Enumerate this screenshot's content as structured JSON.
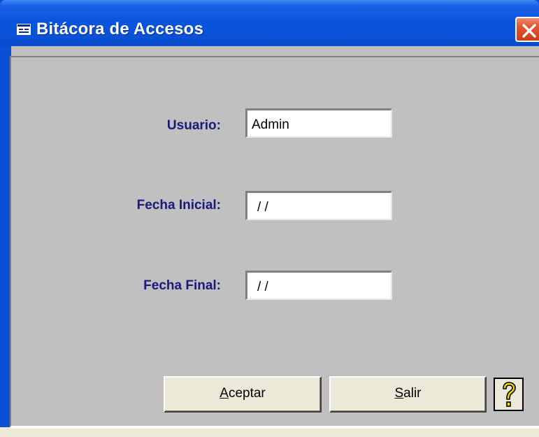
{
  "window": {
    "title": "Bitácora de Accesos",
    "title_icon": "form-window-icon",
    "close_icon": "close-x-icon"
  },
  "form": {
    "usuario_label": "Usuario:",
    "usuario_value": "Admin",
    "fecha_inicial_label": "Fecha Inicial:",
    "fecha_inicial_value": "/ /",
    "fecha_final_label": "Fecha Final:",
    "fecha_final_value": "/ /"
  },
  "buttons": {
    "aceptar_mnemonic": "A",
    "aceptar_rest": "ceptar",
    "salir_mnemonic": "S",
    "salir_rest": "alir",
    "help_icon": "question-mark-icon"
  },
  "colors": {
    "titlebar": "#0855dd",
    "client_background": "#c0c0c0",
    "label_text": "#1a1a7a",
    "close_button": "#e05a33",
    "help_question_mark": "#f0d800"
  }
}
